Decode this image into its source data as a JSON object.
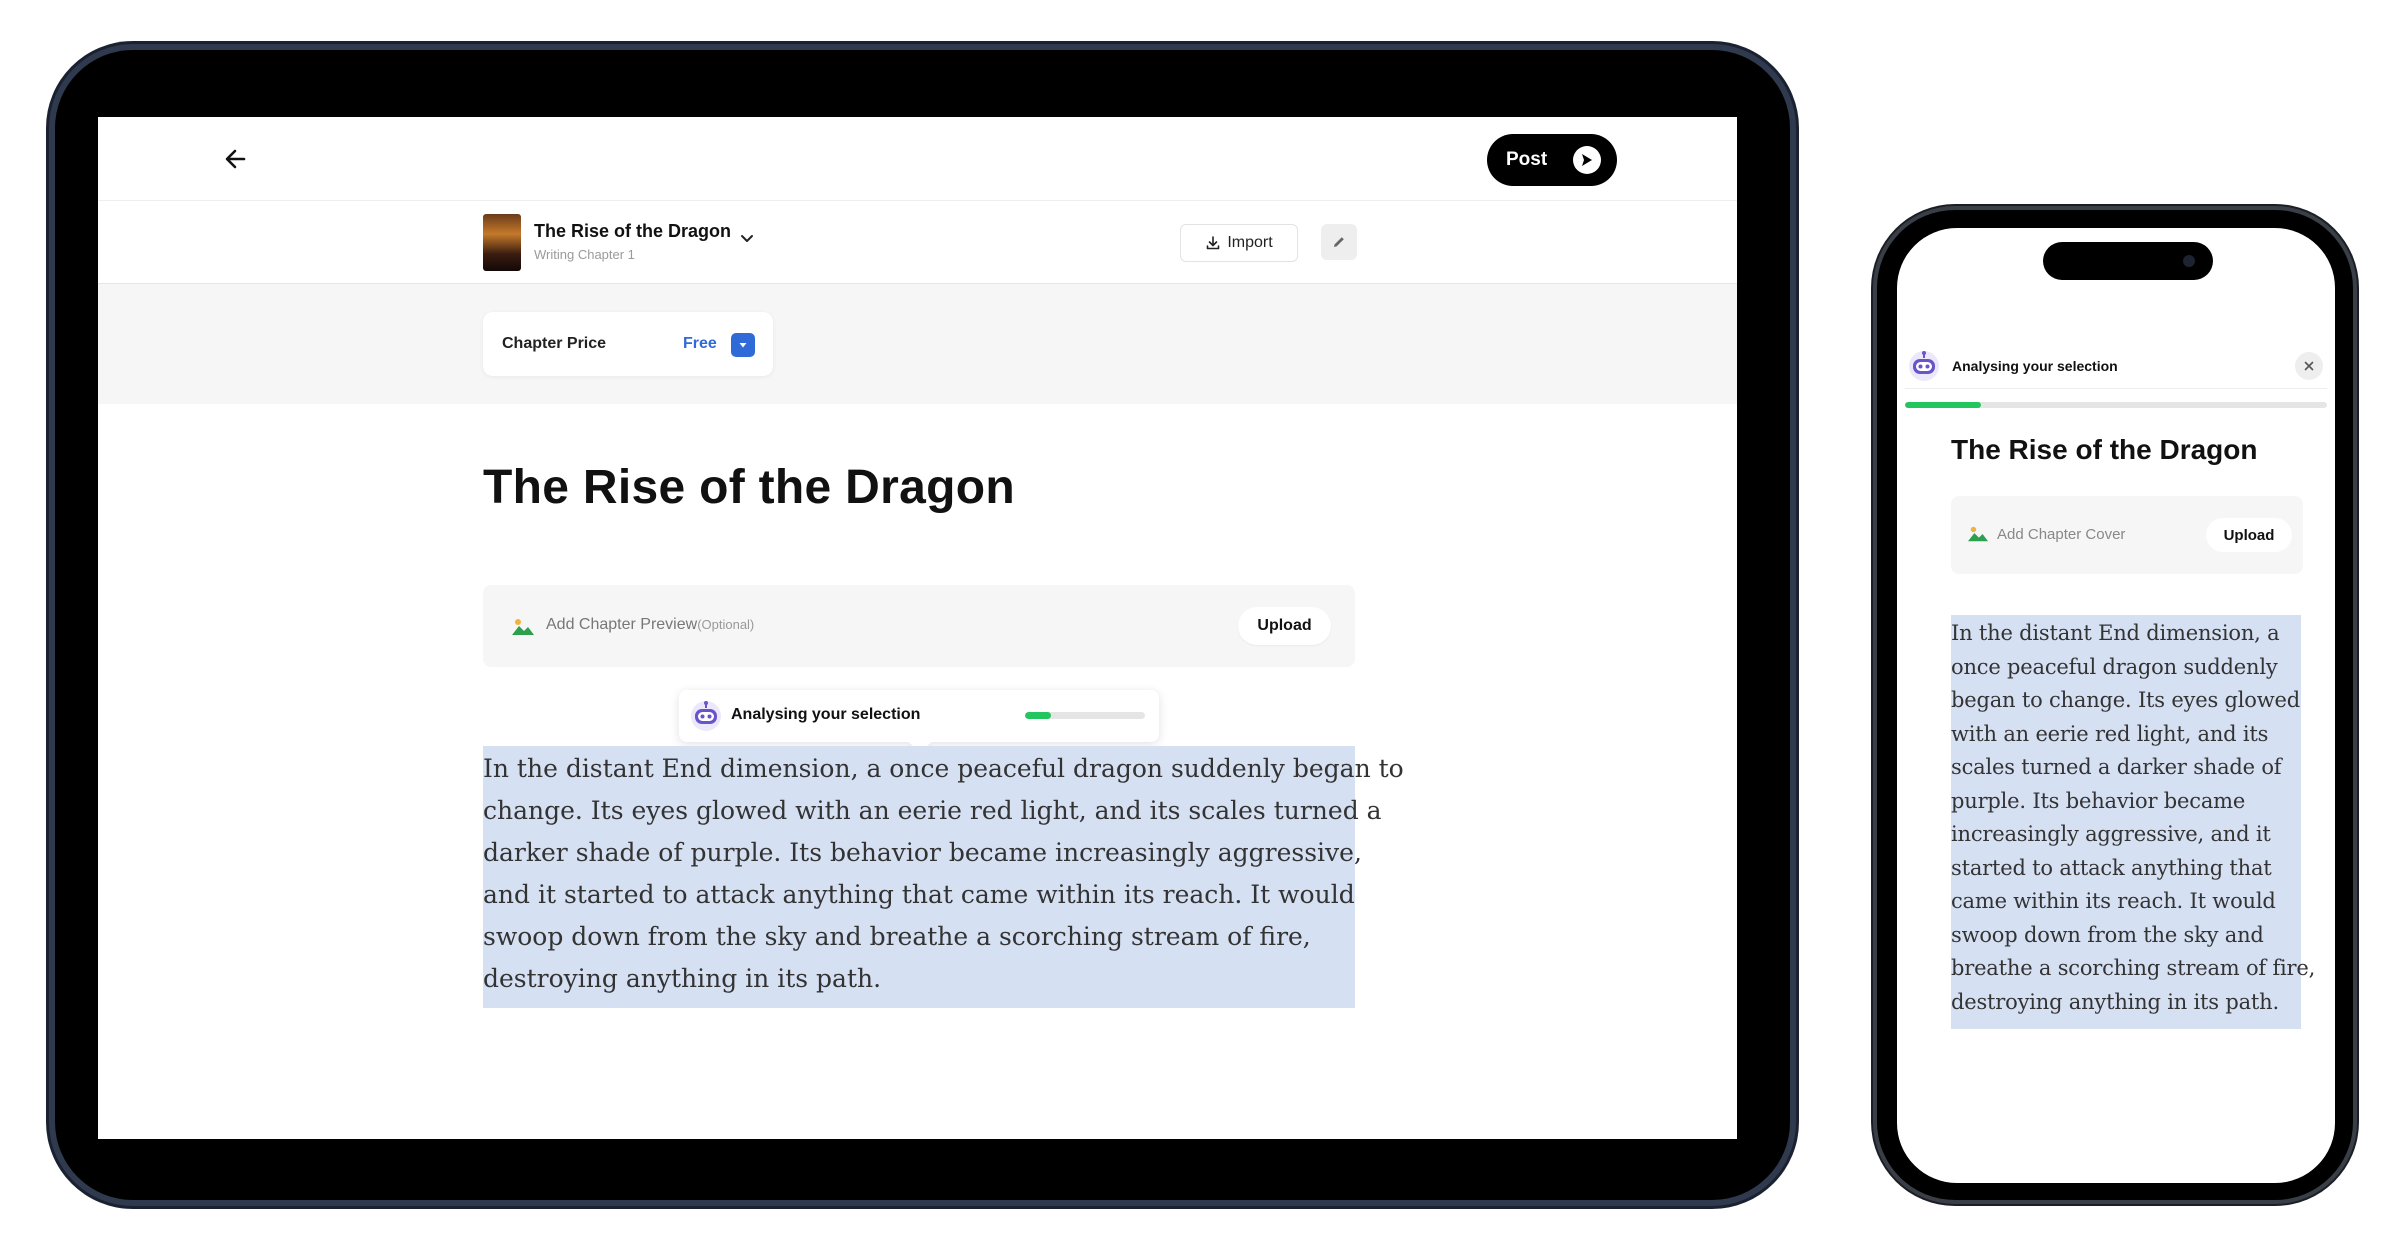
{
  "tablet": {
    "post_label": "Post",
    "book": {
      "title": "The Rise of the Dragon",
      "subtitle": "Writing Chapter 1"
    },
    "import_label": "Import",
    "price": {
      "label": "Chapter Price",
      "value": "Free"
    },
    "chapter_title": "The Rise of the Dragon",
    "preview": {
      "label": "Add Chapter Preview",
      "optional": "(Optional)",
      "upload_label": "Upload"
    },
    "analysis": {
      "text": "Analysing your selection",
      "progress": 0.22
    },
    "body_lines": [
      "In the distant End dimension, a once peaceful dragon suddenly began to",
      "change. Its eyes glowed with an eerie red light, and its scales turned a",
      "darker shade of purple. Its behavior became increasingly aggressive,",
      "and it started to attack anything that came within its reach. It would",
      "swoop down from the sky and breathe a scorching stream of fire,",
      "destroying anything in its path."
    ]
  },
  "phone": {
    "analysis": {
      "text": "Analysing your selection",
      "progress": 0.18
    },
    "chapter_title": "The Rise of the Dragon",
    "cover": {
      "label": "Add Chapter Cover",
      "upload_label": "Upload"
    },
    "body_lines": [
      "In the distant End dimension, a",
      "once peaceful dragon suddenly",
      "began to change. Its eyes glowed",
      "with an eerie red light, and its",
      "scales turned a darker shade of",
      "purple. Its behavior became",
      "increasingly aggressive, and it",
      "started to attack anything that",
      "came within its reach. It would",
      "swoop down from the sky and",
      "breathe a scorching stream of fire,",
      "destroying anything in its path."
    ]
  },
  "colors": {
    "accent_blue": "#2f6bd8",
    "selection": "#d6e0f3",
    "progress_green": "#22c55e"
  },
  "icons": [
    "back-arrow-icon",
    "send-arrow-icon",
    "chevron-down-icon",
    "download-icon",
    "pencil-icon",
    "image-icon",
    "robot-icon",
    "close-icon"
  ]
}
